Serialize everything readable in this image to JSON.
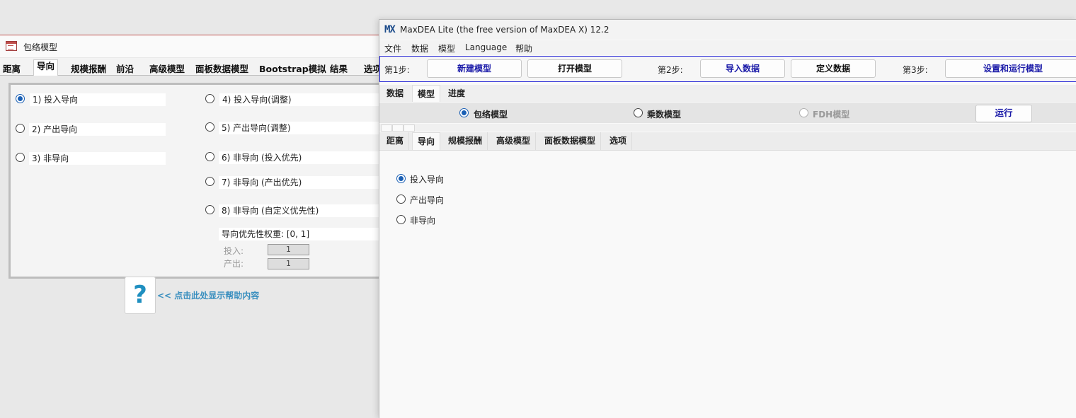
{
  "background_window": {
    "title": "包络模型",
    "tabs": [
      "距离",
      "导向",
      "规模报酬",
      "前沿",
      "高级模型",
      "面板数据模型",
      "Bootstrap模拟",
      "结果",
      "选项"
    ],
    "active_tab": "导向",
    "options_left": [
      "1) 投入导向",
      "2) 产出导向",
      "3) 非导向"
    ],
    "options_right": [
      "4) 投入导向(调整)",
      "5) 产出导向(调整)",
      "6) 非导向 (投入优先)",
      "7) 非导向 (产出优先)",
      "8) 非导向 (自定义优先性)"
    ],
    "selected_option": "1) 投入导向",
    "priority_weight_label": "导向优先性权重: [0, 1]",
    "input_label": "投入:",
    "input_value": "1",
    "output_label": "产出:",
    "output_value": "1",
    "help_icon": "?",
    "help_text": "<< 点击此处显示帮助内容"
  },
  "maxdea_window": {
    "logo": "MX",
    "title": "MaxDEA Lite (the free version of MaxDEA X) 12.2",
    "menu": [
      "文件",
      "数据",
      "模型",
      "Language",
      "帮助"
    ],
    "steps": {
      "step1_label": "第1步:",
      "new_model": "新建模型",
      "open_model": "打开模型",
      "step2_label": "第2步:",
      "import_data": "导入数据",
      "define_data": "定义数据",
      "step3_label": "第3步:",
      "setup_run": "设置和运行模型"
    },
    "top_tabs": [
      "数据",
      "模型",
      "进度"
    ],
    "active_top_tab": "模型",
    "model_types": [
      "包络模型",
      "乘数模型",
      "FDH模型"
    ],
    "selected_model_type": "包络模型",
    "disabled_model_type": "FDH模型",
    "run_button": "运行",
    "sub_tabs": [
      "距离",
      "导向",
      "规模报酬",
      "高级模型",
      "面板数据模型",
      "选项"
    ],
    "active_sub_tab": "导向",
    "orientation_options": [
      "投入导向",
      "产出导向",
      "非导向"
    ],
    "selected_orientation": "投入导向"
  },
  "colors": {
    "accent_blue": "#1a5fb4",
    "button_text_blue": "#1a1aa8",
    "steps_border": "#2b2bd6",
    "help_blue": "#1f8fc0"
  }
}
